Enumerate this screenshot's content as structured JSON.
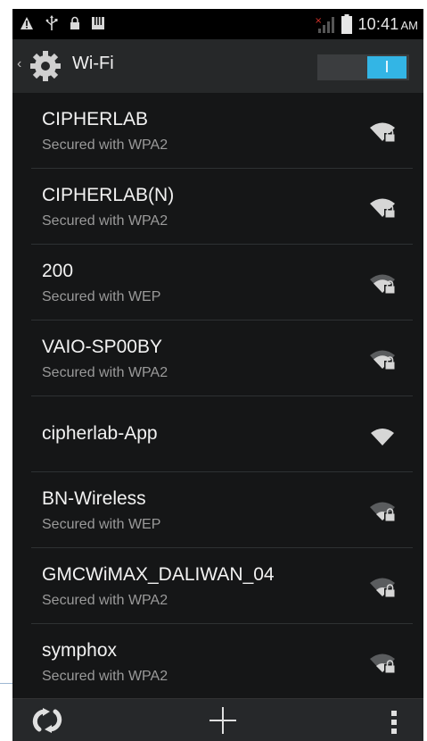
{
  "status_bar": {
    "time": "10:41",
    "ampm": "AM",
    "icons": [
      "warning-icon",
      "usb-icon",
      "lock-icon",
      "storage-icon",
      "no-sim-signal-icon",
      "battery-icon"
    ]
  },
  "action_bar": {
    "back_icon": "chevron-left-icon",
    "app_icon": "gear-icon",
    "title": "Wi-Fi",
    "toggle": {
      "state": "on",
      "label_on": "I"
    }
  },
  "networks": [
    {
      "name": "CIPHERLAB",
      "status": "Secured with WPA2",
      "secured": true,
      "signal": "high"
    },
    {
      "name": "CIPHERLAB(N)",
      "status": "Secured with WPA2",
      "secured": true,
      "signal": "high"
    },
    {
      "name": "200",
      "status": "Secured with WEP",
      "secured": true,
      "signal": "medium"
    },
    {
      "name": "VAIO-SP00BY",
      "status": "Secured with WPA2",
      "secured": true,
      "signal": "medium"
    },
    {
      "name": "cipherlab-App",
      "status": "",
      "secured": false,
      "signal": "high"
    },
    {
      "name": "BN-Wireless",
      "status": "Secured with WEP",
      "secured": true,
      "signal": "low"
    },
    {
      "name": "GMCWiMAX_DALIWAN_04",
      "status": "Secured with WPA2",
      "secured": true,
      "signal": "low"
    },
    {
      "name": "symphox",
      "status": "Secured with WPA2",
      "secured": true,
      "signal": "low"
    }
  ],
  "bottom_bar": {
    "icons": [
      "wps-icon",
      "add-network-icon",
      "overflow-menu-icon"
    ]
  },
  "colors": {
    "accent": "#33b5e5",
    "background": "#151617",
    "action_bar": "#262829",
    "primary_text": "#f2f2f2",
    "secondary_text": "#9a9a9a"
  }
}
